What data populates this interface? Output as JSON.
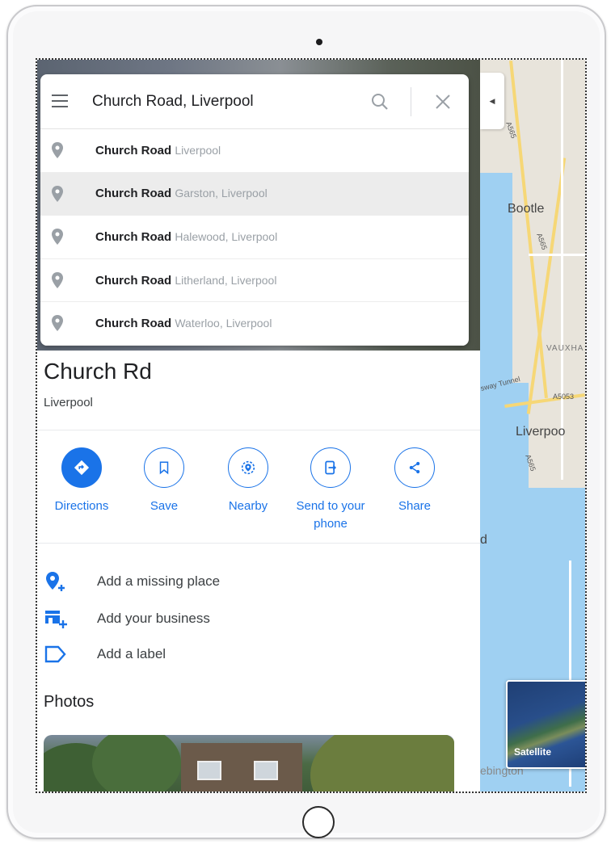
{
  "search": {
    "query": "Church Road, Liverpool",
    "suggestions": [
      {
        "main": "Church Road",
        "sub": "Liverpool"
      },
      {
        "main": "Church Road",
        "sub": "Garston, Liverpool"
      },
      {
        "main": "Church Road",
        "sub": "Halewood, Liverpool"
      },
      {
        "main": "Church Road",
        "sub": "Litherland, Liverpool"
      },
      {
        "main": "Church Road",
        "sub": "Waterloo, Liverpool"
      }
    ],
    "highlighted_index": 1
  },
  "place": {
    "title": "Church Rd",
    "subtitle": "Liverpool"
  },
  "actions": [
    {
      "label": "Directions",
      "icon": "directions-icon"
    },
    {
      "label": "Save",
      "icon": "bookmark-icon"
    },
    {
      "label": "Nearby",
      "icon": "nearby-icon"
    },
    {
      "label": "Send to your phone",
      "icon": "send-to-phone-icon"
    },
    {
      "label": "Share",
      "icon": "share-icon"
    }
  ],
  "extras": [
    {
      "label": "Add a missing place",
      "icon": "add-place-icon"
    },
    {
      "label": "Add your business",
      "icon": "add-business-icon"
    },
    {
      "label": "Add a label",
      "icon": "label-icon"
    }
  ],
  "photos": {
    "title": "Photos"
  },
  "map": {
    "labels": {
      "bootle": "Bootle",
      "liverpool": "Liverpoo",
      "vauxhall": "VAUXHA",
      "tunnel": "sway Tunnel",
      "a5053": "A5053",
      "a565_top": "A565",
      "a565_mid": "A565",
      "a565_low": "A565",
      "partial_d": "d",
      "bebington": "ebington"
    },
    "satellite_label": "Satellite"
  },
  "colors": {
    "accent": "#1a73e8",
    "water": "#9fd0f2",
    "road": "#f6d776"
  }
}
